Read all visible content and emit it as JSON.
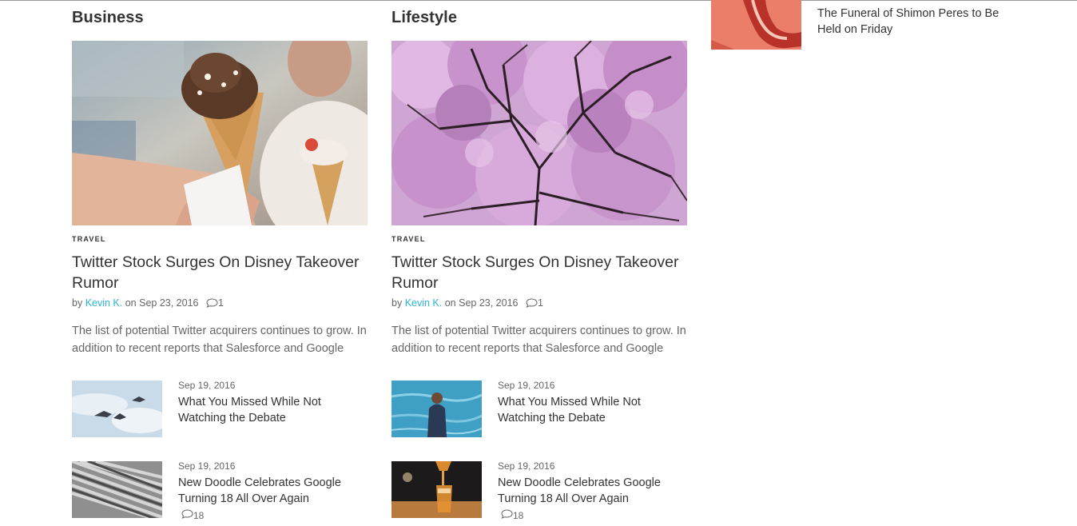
{
  "sections": [
    {
      "title": "Business",
      "featured": {
        "category": "TRAVEL",
        "title": "Twitter Stock Surges On Disney Takeover Rumor",
        "by": "by",
        "author": "Kevin K.",
        "on_date": "on Sep 23, 2016",
        "comments": "1",
        "excerpt": "The list of potential Twitter acquirers continues to grow. In addition to recent reports that Salesforce and Google"
      },
      "items": [
        {
          "date": "Sep 19, 2016",
          "title": "What You Missed While Not Watching the Debate",
          "comments": ""
        },
        {
          "date": "Sep 19, 2016",
          "title": "New Doodle Celebrates Google Turning 18 All Over Again",
          "comments": "18"
        }
      ]
    },
    {
      "title": "Lifestyle",
      "featured": {
        "category": "TRAVEL",
        "title": "Twitter Stock Surges On Disney Takeover Rumor",
        "by": "by",
        "author": "Kevin K.",
        "on_date": "on Sep 23, 2016",
        "comments": "1",
        "excerpt": "The list of potential Twitter acquirers continues to grow. In addition to recent reports that Salesforce and Google"
      },
      "items": [
        {
          "date": "Sep 19, 2016",
          "title": "What You Missed While Not Watching the Debate",
          "comments": ""
        },
        {
          "date": "Sep 19, 2016",
          "title": "New Doodle Celebrates Google Turning 18 All Over Again",
          "comments": "18"
        }
      ]
    }
  ],
  "sidebar": {
    "title": "The Funeral of Shimon Peres to Be Held on Friday"
  },
  "colors": {
    "accent": "#2bb6d9",
    "text": "#333333",
    "muted": "#666666"
  }
}
